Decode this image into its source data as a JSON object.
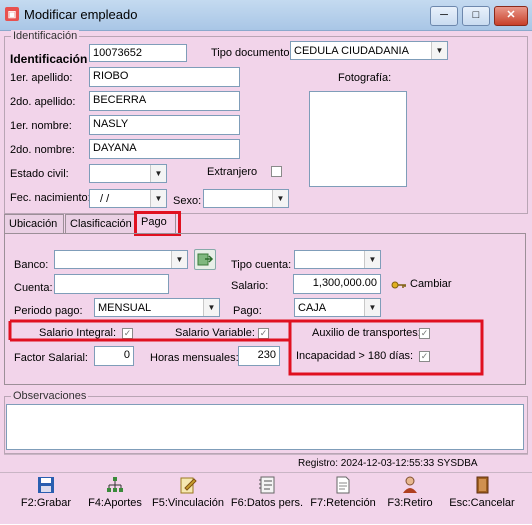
{
  "window": {
    "title": "Modificar empleado",
    "controls": {
      "minimize": "─",
      "maximize": "□",
      "close": "✕"
    }
  },
  "identificacion": {
    "group_title": "Identificación",
    "id_label": "Identificación",
    "id_value": "10073652",
    "tipo_doc_label": "Tipo documento:",
    "tipo_doc_value": "CEDULA CIUDADANIA",
    "apellido1_label": "1er. apellido:",
    "apellido1_value": "RIOBO",
    "apellido2_label": "2do. apellido:",
    "apellido2_value": "BECERRA",
    "nombre1_label": "1er. nombre:",
    "nombre1_value": "NASLY",
    "nombre2_label": "2do. nombre:",
    "nombre2_value": "DAYANA",
    "estado_civil_label": "Estado civil:",
    "estado_civil_value": "",
    "extranjero_label": "Extranjero",
    "fec_nac_label": "Fec. nacimiento:",
    "fec_nac_value": " / /",
    "sexo_label": "Sexo:",
    "sexo_value": "",
    "foto_label": "Fotografía:"
  },
  "tabs": [
    {
      "label": "Ubicación"
    },
    {
      "label": "Clasificación"
    },
    {
      "label": "Pago"
    }
  ],
  "pago": {
    "banco_label": "Banco:",
    "banco_value": "",
    "tipo_cuenta_label": "Tipo cuenta:",
    "tipo_cuenta_value": "",
    "cuenta_label": "Cuenta:",
    "cuenta_value": "",
    "salario_label": "Salario:",
    "salario_value": "1,300,000.00",
    "cambiar_label": "Cambiar",
    "periodo_label": "Periodo pago:",
    "periodo_value": "MENSUAL",
    "pago_label": "Pago:",
    "pago_value": "CAJA",
    "salario_integral_label": "Salario Integral:",
    "salario_variable_label": "Salario Variable:",
    "auxilio_label": "Auxilio de transportes:",
    "factor_label": "Factor Salarial:",
    "factor_value": "0",
    "horas_label": "Horas mensuales:",
    "horas_value": "230",
    "incapacidad_label": "Incapacidad > 180 días:"
  },
  "observaciones": {
    "group_title": "Observaciones",
    "value": ""
  },
  "status": {
    "registro": "Registro: 2024-12-03-12:55:33 SYSDBA"
  },
  "toolbar": [
    {
      "label": "F2:Grabar",
      "icon": "floppy-icon",
      "color": "#2a5fb0"
    },
    {
      "label": "F4:Aportes",
      "icon": "org-chart-icon",
      "color": "#3a8a3a"
    },
    {
      "label": "F5:Vinculación",
      "icon": "clipboard-pencil-icon",
      "color": "#c8a030"
    },
    {
      "label": "F6:Datos pers.",
      "icon": "notebook-icon",
      "color": "#888888"
    },
    {
      "label": "F7:Retención",
      "icon": "document-icon",
      "color": "#666666"
    },
    {
      "label": "F3:Retiro",
      "icon": "person-icon",
      "color": "#b04020"
    },
    {
      "label": "Esc:Cancelar",
      "icon": "exit-door-icon",
      "color": "#a06020"
    }
  ],
  "colors": {
    "window_bg": "#f2d4ea",
    "highlight": "#e01020",
    "titlebar": "#b9d1ea"
  }
}
